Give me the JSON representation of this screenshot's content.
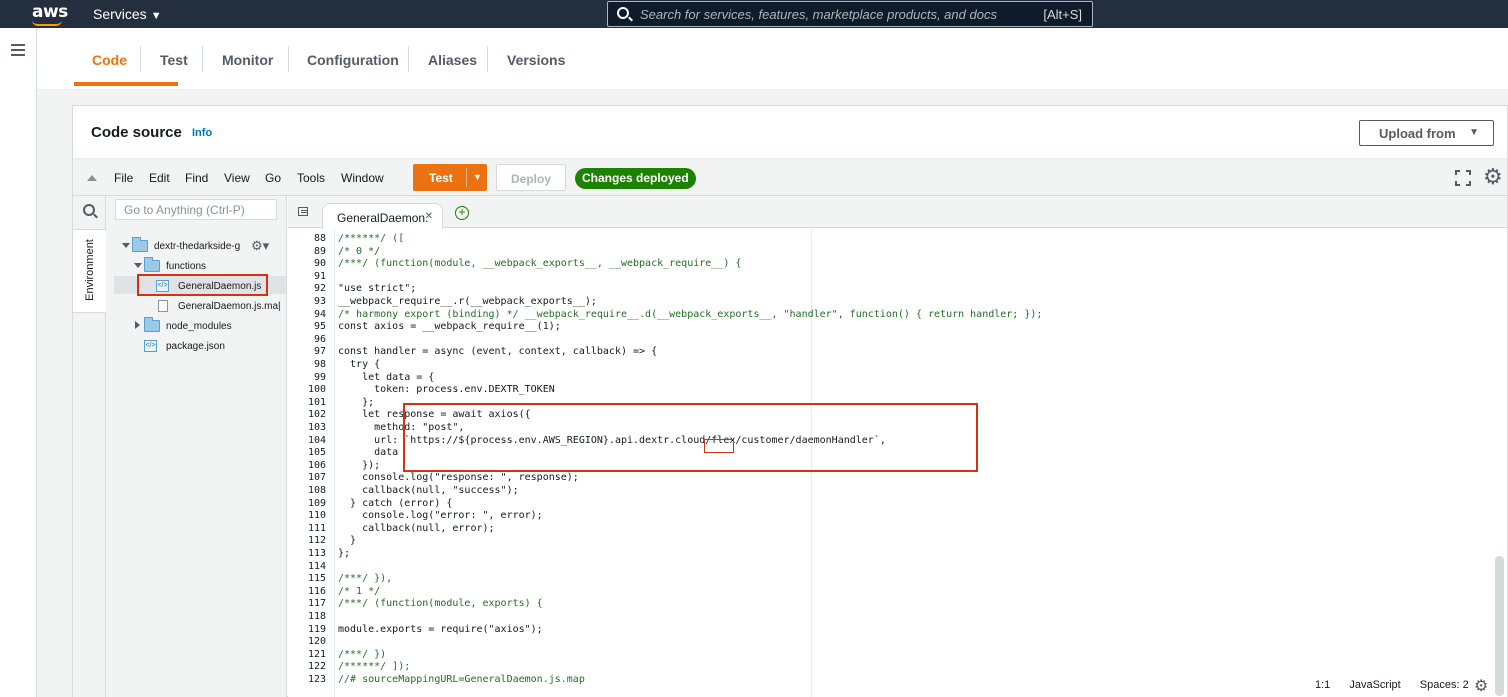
{
  "topnav": {
    "logo": "aws",
    "services_label": "Services",
    "search_placeholder": "Search for services, features, marketplace products, and docs",
    "search_shortcut": "[Alt+S]"
  },
  "tabs": [
    {
      "label": "Code",
      "active": true
    },
    {
      "label": "Test"
    },
    {
      "label": "Monitor"
    },
    {
      "label": "Configuration"
    },
    {
      "label": "Aliases"
    },
    {
      "label": "Versions"
    }
  ],
  "code_source": {
    "title": "Code source",
    "info_label": "Info",
    "upload_label": "Upload from"
  },
  "ide_menu": [
    "File",
    "Edit",
    "Find",
    "View",
    "Go",
    "Tools",
    "Window"
  ],
  "ide_buttons": {
    "test_label": "Test",
    "deploy_label": "Deploy",
    "status_badge": "Changes deployed"
  },
  "env": {
    "tab_label": "Environment",
    "goto_placeholder": "Go to Anything (Ctrl-P)"
  },
  "file_tree": [
    {
      "label": "dextr-thedarkside-g",
      "type": "folder",
      "expanded": true
    },
    {
      "label": "functions",
      "type": "folder",
      "expanded": true
    },
    {
      "label": "GeneralDaemon.js",
      "type": "js",
      "selected": true
    },
    {
      "label": "GeneralDaemon.js.ma|",
      "type": "map"
    },
    {
      "label": "node_modules",
      "type": "folder",
      "expanded": false
    },
    {
      "label": "package.json",
      "type": "json"
    }
  ],
  "editor": {
    "open_tab": "GeneralDaemon.",
    "lines": [
      {
        "n": "88",
        "t": "/******/ (["
      },
      {
        "n": "89",
        "t": "/* 0 */"
      },
      {
        "n": "90",
        "t": "/***/ (function(module, __webpack_exports__, __webpack_require__) {"
      },
      {
        "n": "91",
        "t": ""
      },
      {
        "n": "92",
        "t": "\"use strict\";"
      },
      {
        "n": "93",
        "t": "__webpack_require__.r(__webpack_exports__);"
      },
      {
        "n": "94",
        "t": "/* harmony export (binding) */ __webpack_require__.d(__webpack_exports__, \"handler\", function() { return handler; });"
      },
      {
        "n": "95",
        "t": "const axios = __webpack_require__(1);"
      },
      {
        "n": "96",
        "t": ""
      },
      {
        "n": "97",
        "t": "const handler = async (event, context, callback) => {"
      },
      {
        "n": "98",
        "t": "  try {"
      },
      {
        "n": "99",
        "t": "    let data = {"
      },
      {
        "n": "100",
        "t": "      token: process.env.DEXTR_TOKEN"
      },
      {
        "n": "101",
        "t": "    };"
      },
      {
        "n": "102",
        "t": "    let response = await axios({"
      },
      {
        "n": "103",
        "t": "      method: \"post\","
      },
      {
        "n": "104",
        "t": "      url: `https://${process.env.AWS_REGION}.api.dextr.cloud/flex/customer/daemonHandler`,"
      },
      {
        "n": "105",
        "t": "      data"
      },
      {
        "n": "106",
        "t": "    });"
      },
      {
        "n": "107",
        "t": "    console.log(\"response: \", response);"
      },
      {
        "n": "108",
        "t": "    callback(null, \"success\");"
      },
      {
        "n": "109",
        "t": "  } catch (error) {"
      },
      {
        "n": "110",
        "t": "    console.log(\"error: \", error);"
      },
      {
        "n": "111",
        "t": "    callback(null, error);"
      },
      {
        "n": "112",
        "t": "  }"
      },
      {
        "n": "113",
        "t": "};"
      },
      {
        "n": "114",
        "t": ""
      },
      {
        "n": "115",
        "t": "/***/ }),"
      },
      {
        "n": "116",
        "t": "/* 1 */"
      },
      {
        "n": "117",
        "t": "/***/ (function(module, exports) {"
      },
      {
        "n": "118",
        "t": ""
      },
      {
        "n": "119",
        "t": "module.exports = require(\"axios\");"
      },
      {
        "n": "120",
        "t": ""
      },
      {
        "n": "121",
        "t": "/***/ })"
      },
      {
        "n": "122",
        "t": "/******/ ]);"
      },
      {
        "n": "123",
        "t": "//# sourceMappingURL=GeneralDaemon.js.map"
      }
    ]
  },
  "status": {
    "position": "1:1",
    "language": "JavaScript",
    "spaces": "Spaces: 2"
  },
  "colors": {
    "accent": "#ec7211",
    "success": "#1d8102",
    "topbar": "#232f3e",
    "highlight": "#d13212"
  }
}
